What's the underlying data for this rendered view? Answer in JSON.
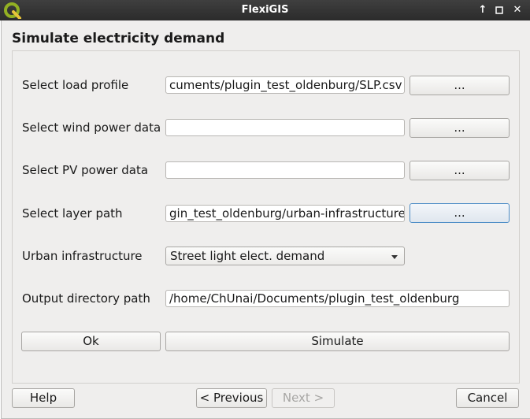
{
  "window": {
    "title": "FlexiGIS"
  },
  "dialog": {
    "heading": "Simulate electricity demand"
  },
  "form": {
    "load_profile": {
      "label": "Select load profile",
      "value": "cuments/plugin_test_oldenburg/SLP.csv",
      "browse": "..."
    },
    "wind_power": {
      "label": "Select wind power data",
      "value": "",
      "browse": "..."
    },
    "pv_power": {
      "label": "Select PV power data",
      "value": "",
      "browse": "..."
    },
    "layer_path": {
      "label": "Select layer path",
      "value": "gin_test_oldenburg/urban-infrastructure",
      "browse": "..."
    },
    "urban_infrastructure": {
      "label": "Urban infrastructure",
      "selected": "Street light elect. demand"
    },
    "output_dir": {
      "label": "Output directory path",
      "value": "/home/ChUnai/Documents/plugin_test_oldenburg"
    },
    "ok_label": "Ok",
    "simulate_label": "Simulate"
  },
  "footer": {
    "help": "Help",
    "previous": "< Previous",
    "next": "Next >",
    "cancel": "Cancel"
  }
}
